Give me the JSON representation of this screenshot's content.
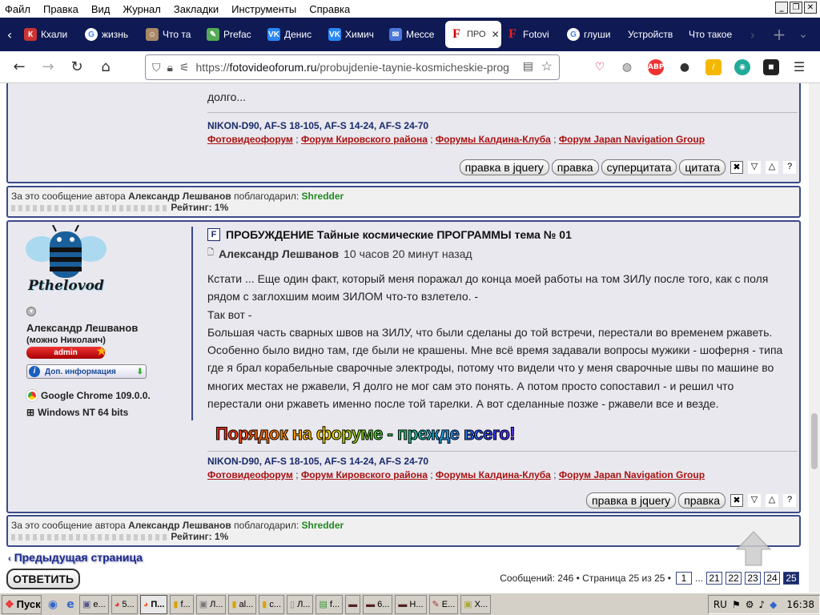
{
  "menubar": {
    "items": [
      "Файл",
      "Правка",
      "Вид",
      "Журнал",
      "Закладки",
      "Инструменты",
      "Справка"
    ]
  },
  "tabs": [
    {
      "label": "Кхали",
      "icon": "red"
    },
    {
      "label": "жизнь",
      "icon": "google"
    },
    {
      "label": "Что та",
      "icon": "person"
    },
    {
      "label": "Prefac",
      "icon": "pencil"
    },
    {
      "label": "Денис",
      "icon": "vk"
    },
    {
      "label": "Химич",
      "icon": "vk"
    },
    {
      "label": "Мессе",
      "icon": "messenger"
    },
    {
      "label": "ПРО",
      "icon": "fotovideo",
      "active": true
    },
    {
      "label": "Fotovi",
      "icon": "fotovideo"
    },
    {
      "label": "глуши",
      "icon": "google"
    },
    {
      "label": "Устройств",
      "icon": "none"
    },
    {
      "label": "Что такое",
      "icon": "none"
    }
  ],
  "url": {
    "prefix": "https://",
    "domain": "fotovideoforum.ru",
    "path": "/probujdenie-taynie-kosmicheskie-prog"
  },
  "post1": {
    "tail": "долго...",
    "sig_gear": "NIKON-D90, AF-S 18-105, AF-S 14-24, AF-S 24-70",
    "sig_links": [
      "Фотовидеофорум",
      "Форум Кировского района",
      "Форумы Калдина-Клуба",
      "Форум Japan Navigation Group"
    ],
    "buttons": [
      "правка в jquery",
      "правка",
      "суперцитата",
      "цитата"
    ]
  },
  "thanks1": {
    "prefix": "За это сообщение автора",
    "author": "Александр Лешванов",
    "mid": "поблагодарил:",
    "user": "Shredder",
    "rating": "Рейтинг: 1%"
  },
  "post2": {
    "avatar_text": "Pthelovod",
    "author": "Александр Лешванов",
    "nickname": "(можно Николаич)",
    "role": "admin",
    "info_button": "Доп. информация",
    "browser": "Google Chrome 109.0.0.",
    "os": "Windows NT 64 bits",
    "title": "ПРОБУЖДЕНИЕ Тайные космические ПРОГРАММЫ тема № 01",
    "byline_author": "Александр Лешванов",
    "time": "10 часов 20 минут назад",
    "lines": [
      "Кстати ... Еще один факт, который меня поражал до конца моей работы на том ЗИЛу после того, как с поля",
      "рядом с заглохшим моим ЗИЛОМ что-то взлетело. -",
      "Так вот -",
      "Большая часть сварных швов на ЗИЛУ, что были сделаны до той встречи, перестали во временем ржаветь.",
      "Особенно было видно там, где были не крашены. Мне всё время задавали вопросы мужики - шоферня - типа",
      "где я брал корабельные сварочные электроды, потому что видели что у меня сварочные швы по машине во",
      "многих местах не ржавели, Я долго не мог сам это понять. А потом просто сопоставил - и решил что",
      "перестали они ржаветь именно после той тарелки. А вот сделанные позже - ржавели все и везде."
    ],
    "banner": "Порядок на форуме - прежде всего!",
    "sig_gear": "NIKON-D90, AF-S 18-105, AF-S 14-24, AF-S 24-70",
    "sig_links": [
      "Фотовидеофорум",
      "Форум Кировского района",
      "Форумы Калдина-Клуба",
      "Форум Japan Navigation Group"
    ],
    "buttons": [
      "правка в jquery",
      "правка"
    ]
  },
  "thanks2": {
    "prefix": "За это сообщение автора",
    "author": "Александр Лешванов",
    "mid": "поблагодарил:",
    "user": "Shredder",
    "rating": "Рейтинг: 1%"
  },
  "footer": {
    "prev": "Предыдущая страница",
    "reply": "ОТВЕТИТЬ",
    "stats": "Сообщений: 246 • Страница 25 из 25 •",
    "pages": [
      "1",
      "...",
      "21",
      "22",
      "23",
      "24",
      "25"
    ]
  },
  "taskbar": {
    "start": "Пуск",
    "items": [
      "e...",
      "5...",
      "П...",
      "f...",
      "Л...",
      "al...",
      "c...",
      "Л...",
      "f...",
      "",
      "6...",
      "Н...",
      "E...",
      "Х..."
    ],
    "lang": "RU",
    "clock": "16:38"
  }
}
